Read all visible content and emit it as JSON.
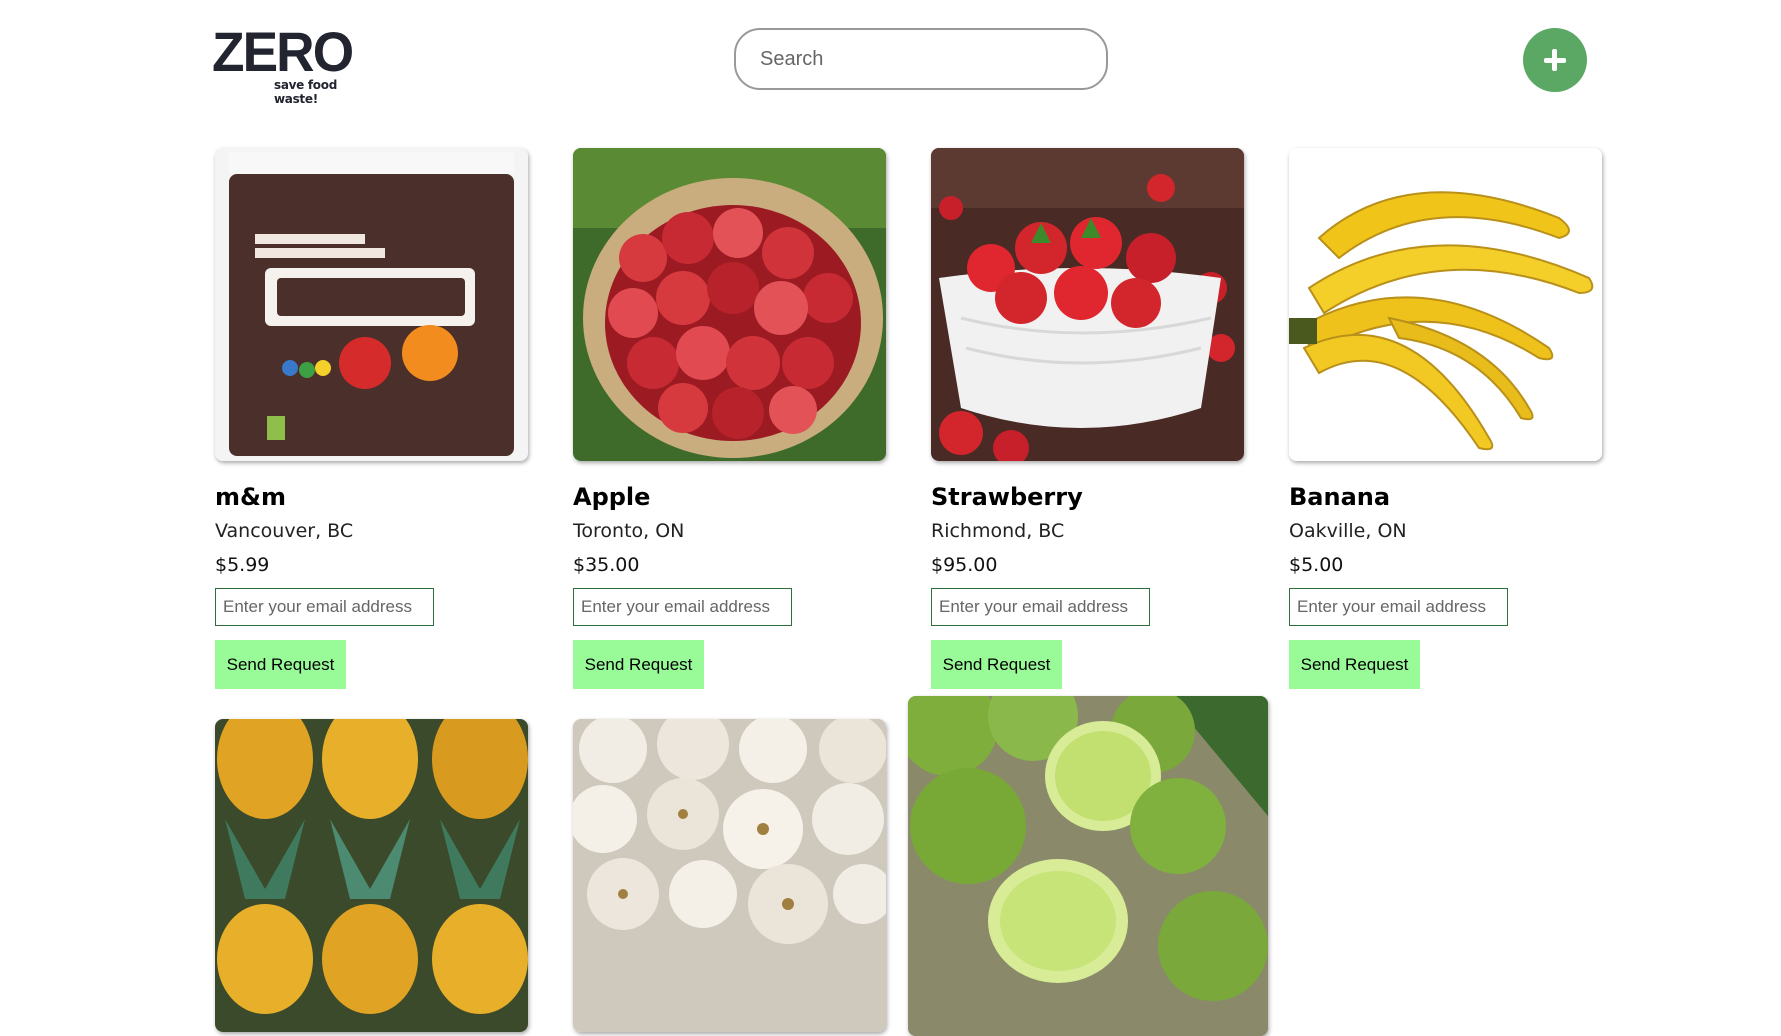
{
  "header": {
    "logo_word": "ZERO",
    "logo_tagline": "save food waste!",
    "search_placeholder": "Search",
    "add_button_icon": "plus-icon",
    "accent_color": "#5ba865"
  },
  "products": [
    {
      "name": "m&m",
      "location": "Vancouver, BC",
      "price": "$5.99",
      "email_placeholder": "Enter your email address",
      "button_label": "Send Request",
      "image": "m-and-m-candy-bag"
    },
    {
      "name": "Apple",
      "location": "Toronto, ON",
      "price": "$35.00",
      "email_placeholder": "Enter your email address",
      "button_label": "Send Request",
      "image": "apples-in-sack"
    },
    {
      "name": "Strawberry",
      "location": "Richmond, BC",
      "price": "$95.00",
      "email_placeholder": "Enter your email address",
      "button_label": "Send Request",
      "image": "strawberries-in-bowl"
    },
    {
      "name": "Banana",
      "location": "Oakville, ON",
      "price": "$5.00",
      "email_placeholder": "Enter your email address",
      "button_label": "Send Request",
      "image": "banana-bunch"
    },
    {
      "image": "pineapples"
    },
    {
      "image": "garlic-bulbs"
    },
    {
      "image": "limes-in-basket"
    }
  ],
  "colors": {
    "send_button": "#98fb98",
    "email_border": "#2f6f3e"
  }
}
